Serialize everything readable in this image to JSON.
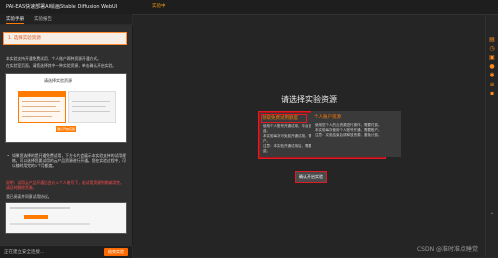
{
  "header": {
    "title": "PAI-EAS快速部署AI绘画Stable Diffusion WebUI",
    "badge": "实验中"
  },
  "tabs": [
    {
      "label": "实验手册"
    },
    {
      "label": "实验报告"
    }
  ],
  "left": {
    "step_title": "1. 选择实验资源",
    "para1": "本实验支持开通免费试用、个人账户两种资源开通方式。",
    "para2": "在实验室页面，请您选择其中一种实验资源，单击确认开启实验。",
    "shot1": {
      "title": "请选择实验资源",
      "subtitle": "",
      "button": "确认开启实验"
    },
    "bullet1": "如果您选择的是开通免费试用，下方卡片会展示本实验支持的试用规格，可以选择您要试用的云产品资源进行开通。您在实验过程中，可以随时用完的1个月额度。",
    "note": "说明：试用云产品开通后会计入个人账号下，若试用资源到期或用完，请及时删除资源。",
    "para3": "我已阅读并同意试用协议。",
    "footer_button": "结束实验"
  },
  "bottom": {
    "hint": "正在建立安全连接..."
  },
  "main": {
    "title": "请选择实验资源",
    "card_trial": {
      "heading": "领取免费试用额度",
      "lines": [
        "使用个人账号开通试用，平台自动计费。",
        "本实验每次可免费开通试用，需要账户。",
        "注意：本实验开通试用后，需要按量付费。"
      ]
    },
    "card_personal": {
      "heading": "个人账户资源",
      "lines": [
        "使用您个人的云资源进行操作，需要付费。",
        "本实验每次使用个人账号开通，需要账户。",
        "注意：实验结束后请释放资源，避免计费。"
      ]
    },
    "confirm_button": "确认开启实验"
  },
  "rail_icons": [
    "document-icon",
    "clock-icon",
    "lock-icon",
    "user-icon",
    "gear-icon",
    "list-icon",
    "chat-icon",
    "chevron-up-icon"
  ],
  "watermark": "CSDN @准时准点睡觉"
}
